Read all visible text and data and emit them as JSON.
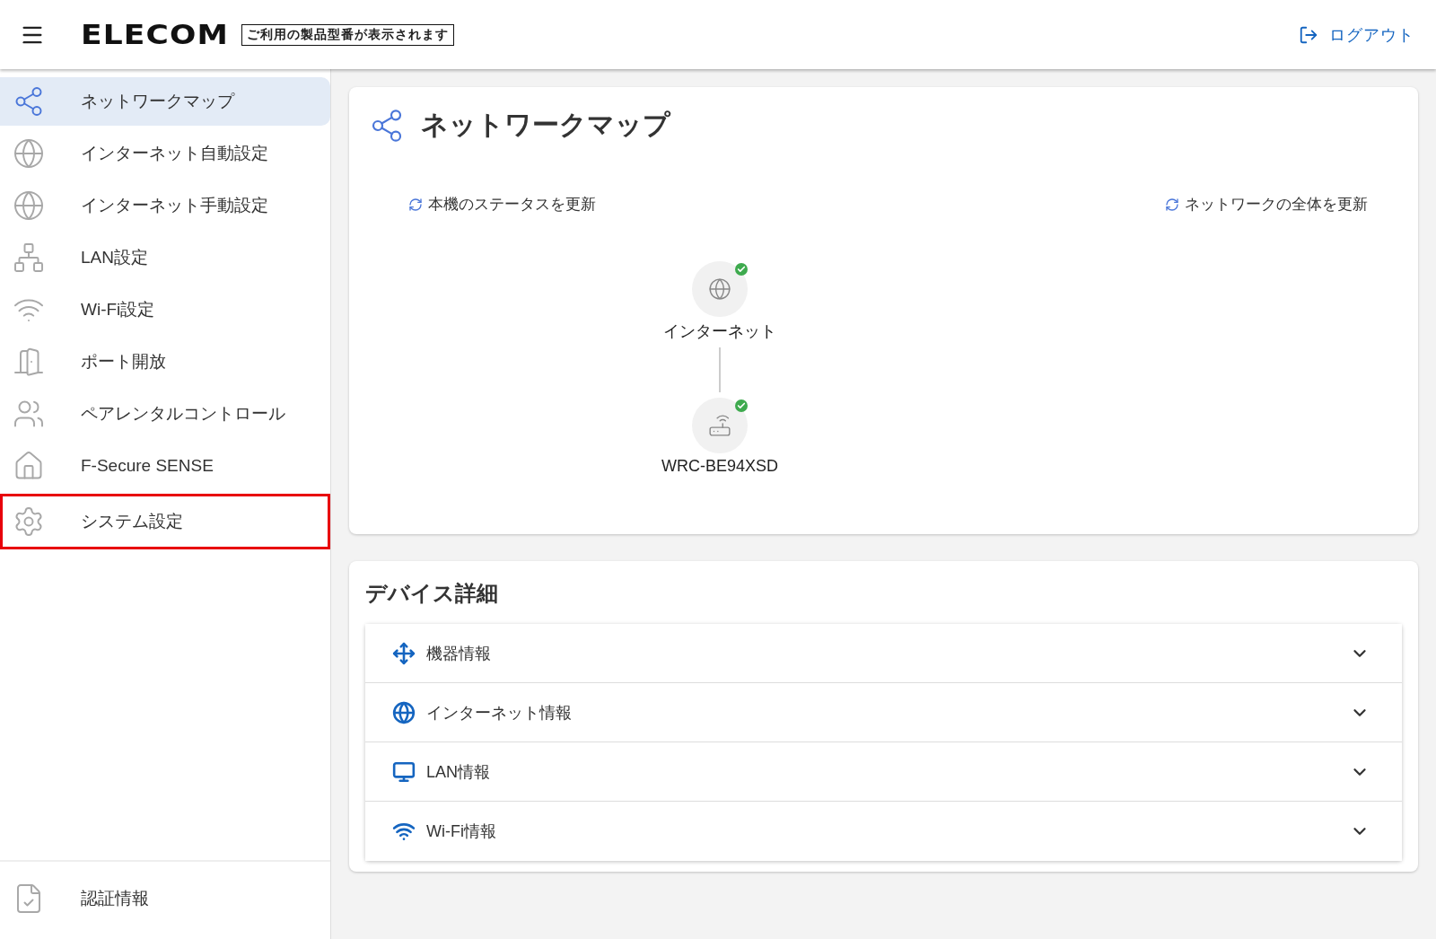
{
  "header": {
    "logo": "ELECOM",
    "model_label": "ご利用の製品型番が表示されます",
    "logout": "ログアウト"
  },
  "sidebar": {
    "items": [
      {
        "label": "ネットワークマップ",
        "kind": "share",
        "selected": true,
        "highlighted": false
      },
      {
        "label": "インターネット自動設定",
        "kind": "globe-auto",
        "selected": false,
        "highlighted": false
      },
      {
        "label": "インターネット手動設定",
        "kind": "globe-manual",
        "selected": false,
        "highlighted": false
      },
      {
        "label": "LAN設定",
        "kind": "lan",
        "selected": false,
        "highlighted": false
      },
      {
        "label": "Wi-Fi設定",
        "kind": "wifi",
        "selected": false,
        "highlighted": false
      },
      {
        "label": "ポート開放",
        "kind": "door",
        "selected": false,
        "highlighted": false
      },
      {
        "label": "ペアレンタルコントロール",
        "kind": "family",
        "selected": false,
        "highlighted": false
      },
      {
        "label": "F-Secure SENSE",
        "kind": "home-shield",
        "selected": false,
        "highlighted": false
      },
      {
        "label": "システム設定",
        "kind": "gear",
        "selected": false,
        "highlighted": true
      }
    ],
    "footer_item": {
      "label": "認証情報"
    }
  },
  "network_map": {
    "title": "ネットワークマップ",
    "refresh_device": "本機のステータスを更新",
    "refresh_all": "ネットワークの全体を更新",
    "nodes": [
      {
        "label": "インターネット",
        "kind": "globe",
        "ok": true
      },
      {
        "label": "WRC-BE94XSD",
        "kind": "router",
        "ok": true
      }
    ]
  },
  "device_details": {
    "title": "デバイス詳細",
    "sections": [
      {
        "label": "機器情報",
        "kind": "device",
        "expanded": false
      },
      {
        "label": "インターネット情報",
        "kind": "globe",
        "expanded": false
      },
      {
        "label": "LAN情報",
        "kind": "lan",
        "expanded": false
      },
      {
        "label": "Wi-Fi情報",
        "kind": "wifi",
        "expanded": false
      }
    ]
  }
}
